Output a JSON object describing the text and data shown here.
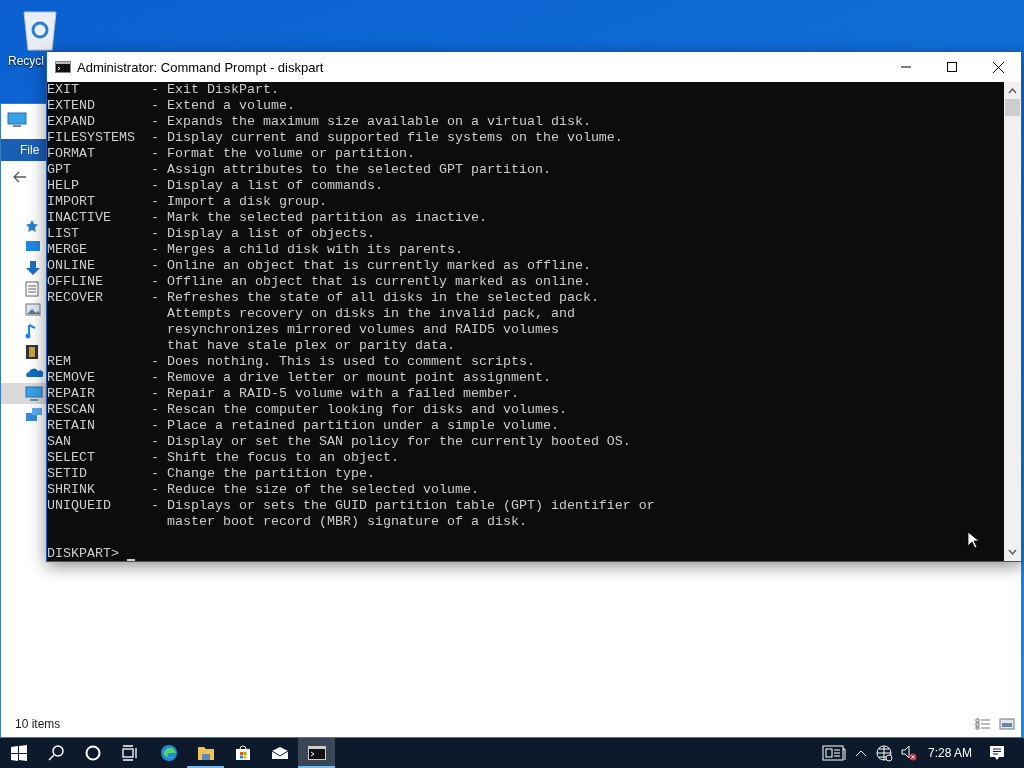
{
  "desktop": {
    "icons": [
      {
        "label": "Recycl"
      }
    ]
  },
  "explorer": {
    "ribbon_tab": "File",
    "nav_items": [
      {
        "kind": "star",
        "selected": false
      },
      {
        "kind": "desktop",
        "selected": false
      },
      {
        "kind": "download",
        "selected": false
      },
      {
        "kind": "document",
        "selected": false
      },
      {
        "kind": "picture",
        "selected": false
      },
      {
        "kind": "music",
        "selected": false
      },
      {
        "kind": "video",
        "selected": false
      },
      {
        "kind": "cloud",
        "selected": false
      },
      {
        "kind": "pc",
        "selected": true
      },
      {
        "kind": "network",
        "selected": false
      }
    ],
    "status_bar": "10 items"
  },
  "console_window": {
    "title": "Administrator: Command Prompt - diskpart",
    "lines": [
      "EXIT         - Exit DiskPart.",
      "EXTEND       - Extend a volume.",
      "EXPAND       - Expands the maximum size available on a virtual disk.",
      "FILESYSTEMS  - Display current and supported file systems on the volume.",
      "FORMAT       - Format the volume or partition.",
      "GPT          - Assign attributes to the selected GPT partition.",
      "HELP         - Display a list of commands.",
      "IMPORT       - Import a disk group.",
      "INACTIVE     - Mark the selected partition as inactive.",
      "LIST         - Display a list of objects.",
      "MERGE        - Merges a child disk with its parents.",
      "ONLINE       - Online an object that is currently marked as offline.",
      "OFFLINE      - Offline an object that is currently marked as online.",
      "RECOVER      - Refreshes the state of all disks in the selected pack.",
      "               Attempts recovery on disks in the invalid pack, and",
      "               resynchronizes mirrored volumes and RAID5 volumes",
      "               that have stale plex or parity data.",
      "REM          - Does nothing. This is used to comment scripts.",
      "REMOVE       - Remove a drive letter or mount point assignment.",
      "REPAIR       - Repair a RAID-5 volume with a failed member.",
      "RESCAN       - Rescan the computer looking for disks and volumes.",
      "RETAIN       - Place a retained partition under a simple volume.",
      "SAN          - Display or set the SAN policy for the currently booted OS.",
      "SELECT       - Shift the focus to an object.",
      "SETID        - Change the partition type.",
      "SHRINK       - Reduce the size of the selected volume.",
      "UNIQUEID     - Displays or sets the GUID partition table (GPT) identifier or",
      "               master boot record (MBR) signature of a disk."
    ],
    "prompt": "DISKPART>"
  },
  "taskbar": {
    "apps": [
      {
        "kind": "start",
        "running": false,
        "selected": false
      },
      {
        "kind": "search",
        "running": false,
        "selected": false
      },
      {
        "kind": "cortana",
        "running": false,
        "selected": false
      },
      {
        "kind": "taskview",
        "running": false,
        "selected": false
      },
      {
        "kind": "edge",
        "running": false,
        "selected": false
      },
      {
        "kind": "explorer",
        "running": true,
        "selected": false
      },
      {
        "kind": "store",
        "running": false,
        "selected": false
      },
      {
        "kind": "mail",
        "running": false,
        "selected": false
      },
      {
        "kind": "cmd",
        "running": true,
        "selected": true
      }
    ],
    "clock": "7:28 AM"
  }
}
